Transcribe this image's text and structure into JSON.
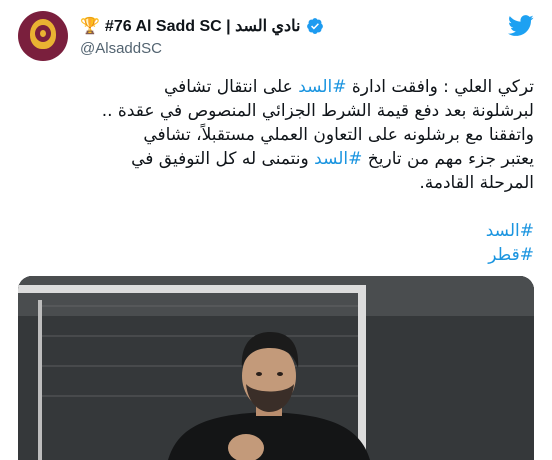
{
  "account": {
    "trophy_icon": "🏆",
    "display_name": "#76 Al Sadd SC | نادي السد",
    "handle": "@AlsaddSC",
    "verified": true
  },
  "tweet": {
    "lines": [
      [
        "تركي العلي : وافقت ادارة ",
        "#السد",
        " على انتقال تشافي"
      ],
      [
        "لبرشلونة بعد دفع قيمة الشرط الجزائي المنصوص في عقدة .."
      ],
      [
        "واتفقنا مع برشلونه على التعاون العملي مستقبلاً، تشافي"
      ],
      [
        "يعتبر جزء مهم من تاريخ ",
        "#السد",
        " ونتمنى له كل التوفيق في"
      ],
      [
        "المرحلة القادمة."
      ]
    ],
    "hashtags": [
      "#السد",
      "#قطر"
    ]
  },
  "colors": {
    "link": "#1b95e0",
    "brand": "#1da1f2",
    "verified": "#1d9bf0",
    "avatar_bg": "#7a1f3d",
    "avatar_gold": "#e9b232"
  },
  "icons": [
    "trophy-icon",
    "verified-badge-icon",
    "twitter-bird-icon"
  ]
}
